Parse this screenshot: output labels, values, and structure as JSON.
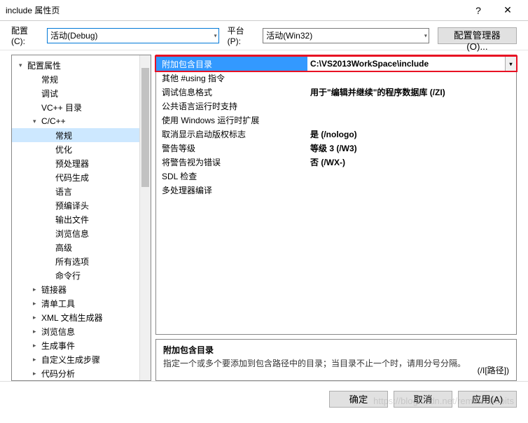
{
  "window": {
    "title": "include 属性页",
    "help": "?",
    "close": "✕"
  },
  "toolbar": {
    "config_label": "配置(C):",
    "config_value": "活动(Debug)",
    "platform_label": "平台(P):",
    "platform_value": "活动(Win32)",
    "config_manager": "配置管理器(O)..."
  },
  "tree": [
    {
      "level": 0,
      "label": "配置属性",
      "arrow": "▾"
    },
    {
      "level": 1,
      "label": "常规"
    },
    {
      "level": 1,
      "label": "调试"
    },
    {
      "level": 1,
      "label": "VC++ 目录"
    },
    {
      "level": 1,
      "label": "C/C++",
      "arrow": "▾"
    },
    {
      "level": 2,
      "label": "常规",
      "selected": true
    },
    {
      "level": 2,
      "label": "优化"
    },
    {
      "level": 2,
      "label": "预处理器"
    },
    {
      "level": 2,
      "label": "代码生成"
    },
    {
      "level": 2,
      "label": "语言"
    },
    {
      "level": 2,
      "label": "预编译头"
    },
    {
      "level": 2,
      "label": "输出文件"
    },
    {
      "level": 2,
      "label": "浏览信息"
    },
    {
      "level": 2,
      "label": "高级"
    },
    {
      "level": 2,
      "label": "所有选项"
    },
    {
      "level": 2,
      "label": "命令行"
    },
    {
      "level": 1,
      "label": "链接器",
      "arrow": "▸"
    },
    {
      "level": 1,
      "label": "清单工具",
      "arrow": "▸"
    },
    {
      "level": 1,
      "label": "XML 文档生成器",
      "arrow": "▸"
    },
    {
      "level": 1,
      "label": "浏览信息",
      "arrow": "▸"
    },
    {
      "level": 1,
      "label": "生成事件",
      "arrow": "▸"
    },
    {
      "level": 1,
      "label": "自定义生成步骤",
      "arrow": "▸"
    },
    {
      "level": 1,
      "label": "代码分析",
      "arrow": "▸"
    }
  ],
  "properties": [
    {
      "name": "附加包含目录",
      "value": "C:\\VS2013WorkSpace\\include",
      "highlighted": true
    },
    {
      "name": "其他 #using 指令",
      "value": ""
    },
    {
      "name": "调试信息格式",
      "value": "用于\"编辑并继续\"的程序数据库 (/ZI)"
    },
    {
      "name": "公共语言运行时支持",
      "value": ""
    },
    {
      "name": "使用 Windows 运行时扩展",
      "value": ""
    },
    {
      "name": "取消显示启动版权标志",
      "value": "是 (/nologo)"
    },
    {
      "name": "警告等级",
      "value": "等级 3 (/W3)"
    },
    {
      "name": "将警告视为错误",
      "value": "否 (/WX-)"
    },
    {
      "name": "SDL 检查",
      "value": ""
    },
    {
      "name": "多处理器编译",
      "value": ""
    }
  ],
  "description": {
    "title": "附加包含目录",
    "text": "指定一个或多个要添加到包含路径中的目录；当目录不止一个时，请用分号分隔。",
    "right": "(/I[路径])"
  },
  "footer": {
    "ok": "确定",
    "cancel": "取消",
    "apply": "应用(A)"
  },
  "watermark": "https://blog.csdn.net/remindchobits"
}
